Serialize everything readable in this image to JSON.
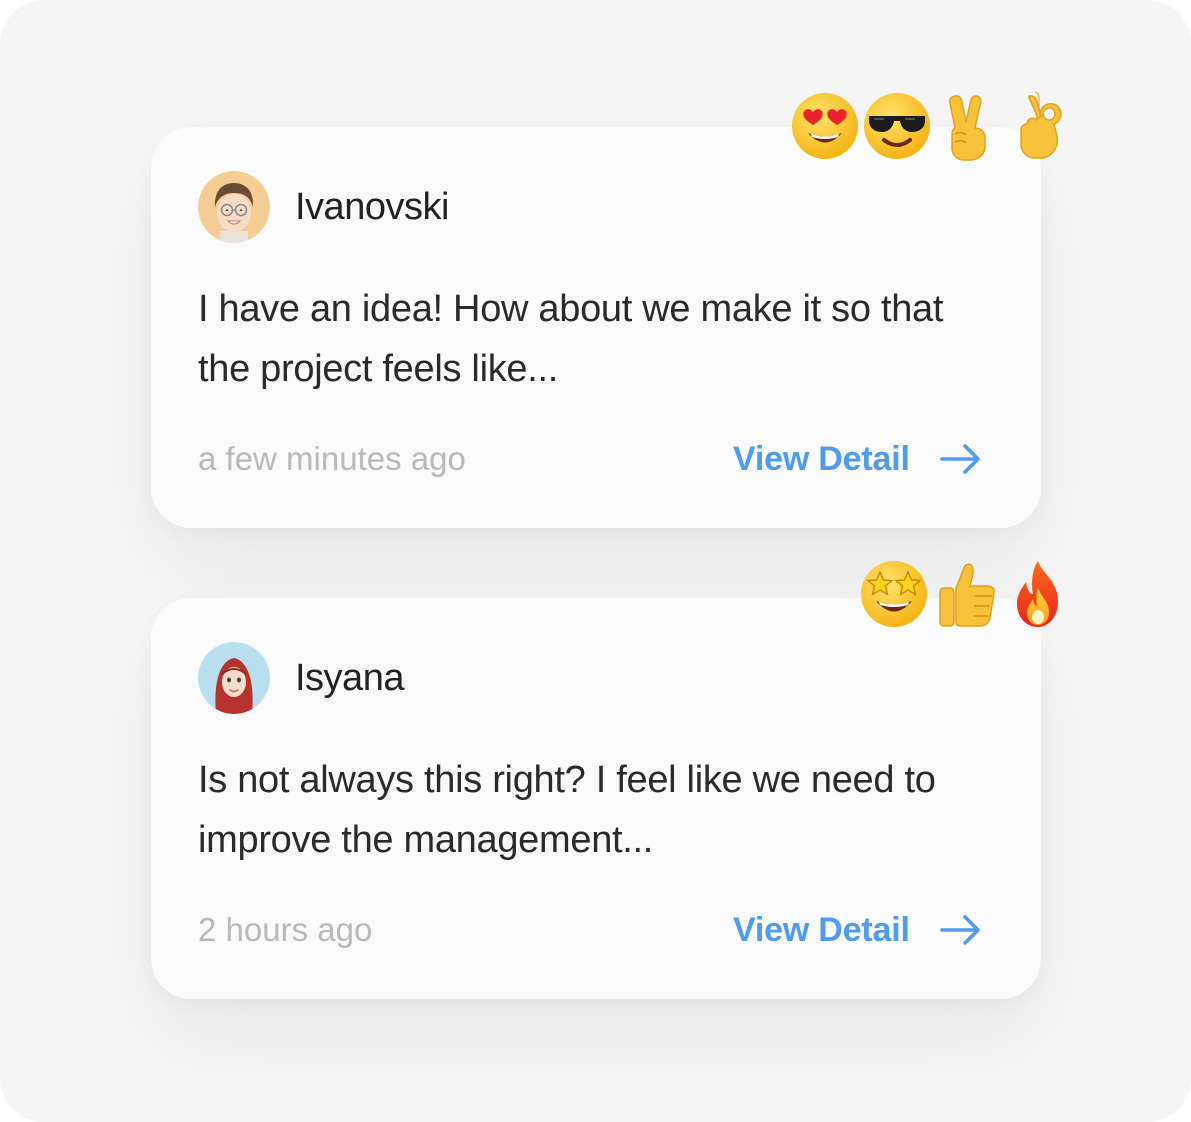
{
  "comments": [
    {
      "name": "Ivanovski",
      "message": "I have an idea! How about we make it so that the project feels like...",
      "time": "a few minutes ago",
      "action_label": "View Detail",
      "avatar_bg": "#f4cc94",
      "reactions": [
        "heart-eyes-emoji",
        "sunglasses-emoji",
        "victory-hand-emoji",
        "ok-hand-emoji"
      ]
    },
    {
      "name": "Isyana",
      "message": "Is not always this right? I feel like we need to improve the management...",
      "time": "2 hours ago",
      "action_label": "View Detail",
      "avatar_bg": "#b9def0",
      "reactions": [
        "star-struck-emoji",
        "thumbs-up-emoji",
        "fire-emoji"
      ]
    }
  ],
  "colors": {
    "accent": "#4f9bee",
    "name_text": "#222222",
    "muted_text": "#b8b8b8",
    "card_bg": "#fafafa",
    "page_bg": "#f5f5f5"
  }
}
